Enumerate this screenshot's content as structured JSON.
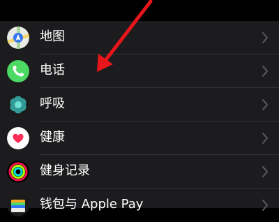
{
  "settings": {
    "items": [
      {
        "label": "地图",
        "icon": "maps-icon"
      },
      {
        "label": "电话",
        "icon": "phone-icon"
      },
      {
        "label": "呼吸",
        "icon": "breathe-icon"
      },
      {
        "label": "健康",
        "icon": "health-icon"
      },
      {
        "label": "健身记录",
        "icon": "activity-icon"
      },
      {
        "label": "钱包与 Apple Pay",
        "icon": "wallet-icon"
      }
    ]
  },
  "colors": {
    "background": "#000000",
    "list_background": "#1c1c1e",
    "separator": "#333336",
    "chevron": "#5a5a5e",
    "annotation_arrow": "#e8161b"
  }
}
